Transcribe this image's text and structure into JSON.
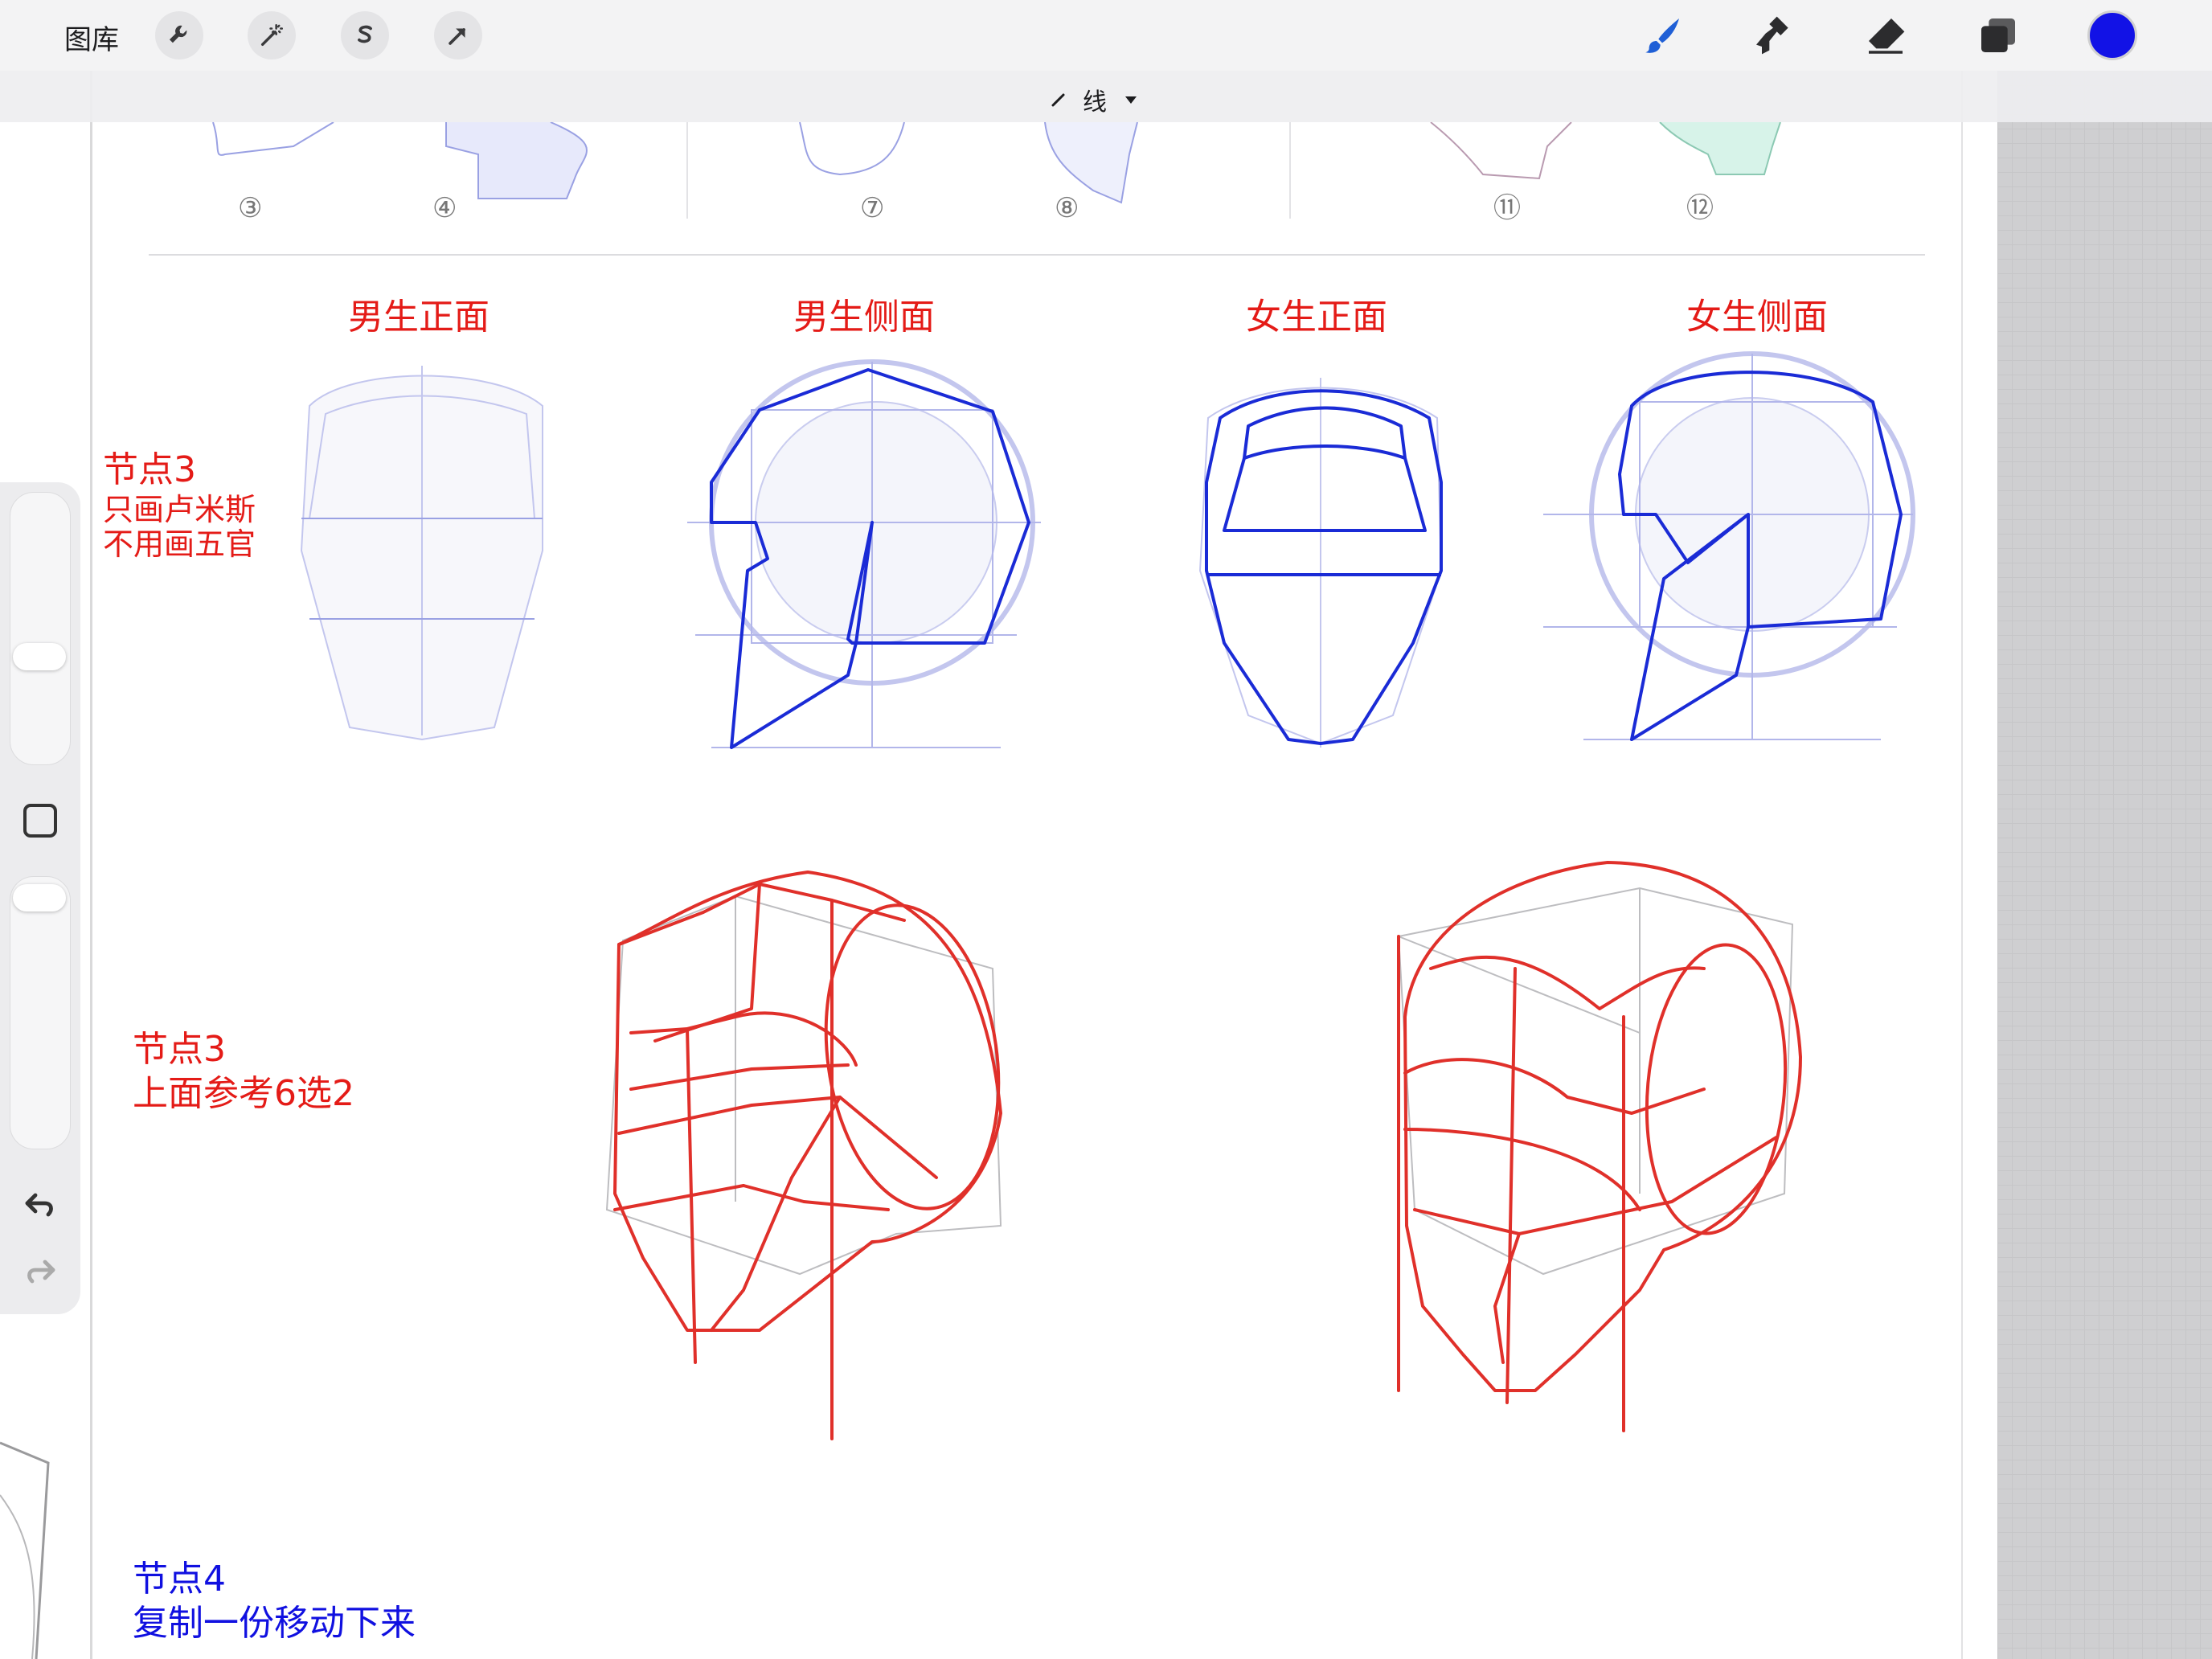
{
  "toolbar": {
    "gallery_label": "图库",
    "left_tools": [
      "wrench-icon",
      "magic-wand-icon",
      "selection-s-icon",
      "transform-arrow-icon"
    ],
    "right_tools": [
      "brush-icon",
      "smudge-icon",
      "eraser-icon",
      "layers-icon"
    ],
    "current_color": "#1212e6"
  },
  "layer_bar": {
    "layer_name": "线"
  },
  "top_strip": {
    "step_markers": [
      "③",
      "④",
      "⑦",
      "⑧",
      "⑪",
      "⑫"
    ]
  },
  "view_titles": {
    "male_front": "男生正面",
    "male_side": "男生侧面",
    "female_front": "女生正面",
    "female_side": "女生侧面"
  },
  "notes": {
    "node3_a_title": "节点3",
    "node3_a_line1": "只画卢米斯",
    "node3_a_line2": "不用画五官",
    "node3_b_title": "节点3",
    "node3_b_line1": "上面参考6选2",
    "node4_title": "节点4",
    "node4_line1": "复制一份移动下来"
  },
  "colors": {
    "red": "#e41b17",
    "blue": "#1010e0",
    "sketch_blue": "#1a2bd6",
    "guide": "#b9bde6"
  },
  "sidebar": {
    "square_button_icon": "square-icon",
    "undo_icon": "undo-icon",
    "redo_icon": "redo-icon"
  }
}
